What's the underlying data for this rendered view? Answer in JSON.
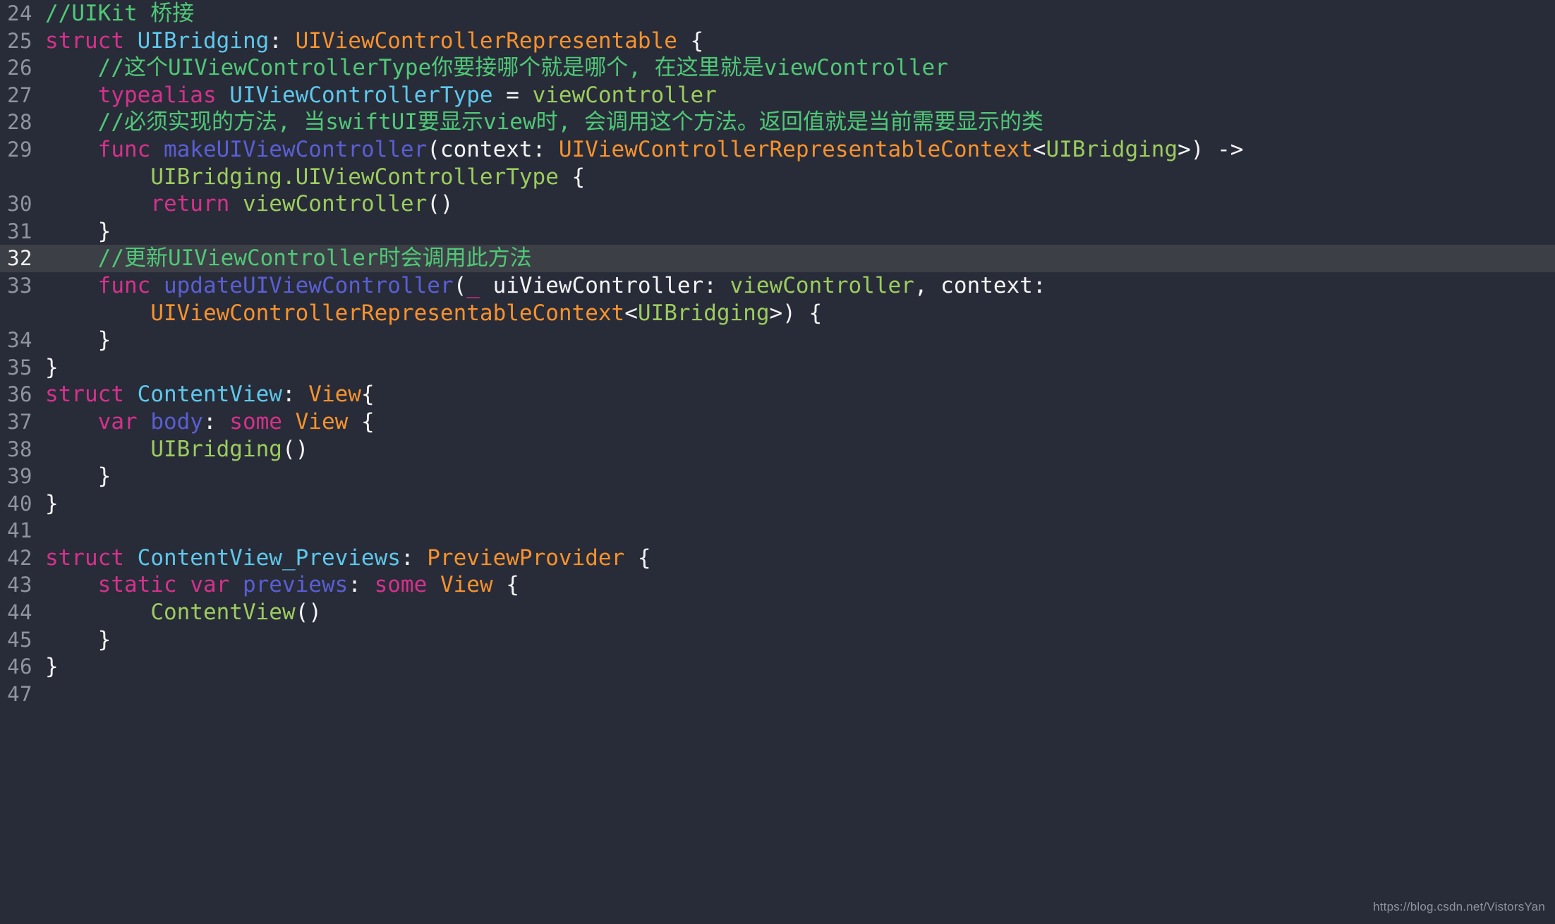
{
  "editor": {
    "theme": {
      "background": "#282c38",
      "active_line_background": "#3c3f45",
      "gutter_text": "#9093a0",
      "gutter_active_text": "#f2f2f4",
      "comment": "#50c878",
      "keyword": "#d6318c",
      "type_declaration": "#5ec8ec",
      "protocol_type": "#f7922e",
      "identifier": "#9ccc5e",
      "function_name": "#5a5ed4",
      "plain": "#f4f4f6"
    },
    "active_line_number": "32",
    "watermark": "https://blog.csdn.net/VistorsYan",
    "lines": [
      {
        "number": "24",
        "active": false,
        "tokens": [
          {
            "c": "cmt",
            "t": "//UIKit 桥接"
          }
        ]
      },
      {
        "number": "25",
        "active": false,
        "tokens": [
          {
            "c": "kw",
            "t": "struct "
          },
          {
            "c": "type",
            "t": "UIBridging"
          },
          {
            "c": "pln",
            "t": ": "
          },
          {
            "c": "prot",
            "t": "UIViewControllerRepresentable"
          },
          {
            "c": "pln",
            "t": " {"
          }
        ]
      },
      {
        "number": "26",
        "active": false,
        "tokens": [
          {
            "c": "cmt",
            "t": "    //这个UIViewControllerType你要接哪个就是哪个, 在这里就是viewController"
          }
        ]
      },
      {
        "number": "27",
        "active": false,
        "tokens": [
          {
            "c": "pln",
            "t": "    "
          },
          {
            "c": "kw",
            "t": "typealias "
          },
          {
            "c": "type",
            "t": "UIViewControllerType"
          },
          {
            "c": "pln",
            "t": " = "
          },
          {
            "c": "idf",
            "t": "viewController"
          }
        ]
      },
      {
        "number": "28",
        "active": false,
        "tokens": [
          {
            "c": "cmt",
            "t": "    //必须实现的方法, 当swiftUI要显示view时, 会调用这个方法。返回值就是当前需要显示的类"
          }
        ]
      },
      {
        "number": "29",
        "active": false,
        "tokens": [
          {
            "c": "pln",
            "t": "    "
          },
          {
            "c": "kw",
            "t": "func "
          },
          {
            "c": "fn",
            "t": "makeUIViewController"
          },
          {
            "c": "pln",
            "t": "(context: "
          },
          {
            "c": "prot",
            "t": "UIViewControllerRepresentableContext"
          },
          {
            "c": "pln",
            "t": "<"
          },
          {
            "c": "idf",
            "t": "UIBridging"
          },
          {
            "c": "pln",
            "t": ">) ->"
          }
        ]
      },
      {
        "number": "",
        "active": false,
        "tokens": [
          {
            "c": "pln",
            "t": "        "
          },
          {
            "c": "idf",
            "t": "UIBridging.UIViewControllerType"
          },
          {
            "c": "pln",
            "t": " {"
          }
        ]
      },
      {
        "number": "30",
        "active": false,
        "tokens": [
          {
            "c": "pln",
            "t": "        "
          },
          {
            "c": "kw",
            "t": "return "
          },
          {
            "c": "idf",
            "t": "viewController"
          },
          {
            "c": "pln",
            "t": "()"
          }
        ]
      },
      {
        "number": "31",
        "active": false,
        "tokens": [
          {
            "c": "pln",
            "t": "    }"
          }
        ]
      },
      {
        "number": "32",
        "active": true,
        "tokens": [
          {
            "c": "cmt",
            "t": "    //更新UIViewController时会调用此方法"
          }
        ]
      },
      {
        "number": "33",
        "active": false,
        "tokens": [
          {
            "c": "pln",
            "t": "    "
          },
          {
            "c": "kw",
            "t": "func "
          },
          {
            "c": "fn",
            "t": "updateUIViewController"
          },
          {
            "c": "pln",
            "t": "("
          },
          {
            "c": "kw",
            "t": "_"
          },
          {
            "c": "pln",
            "t": " uiViewController: "
          },
          {
            "c": "idf",
            "t": "viewController"
          },
          {
            "c": "pln",
            "t": ", context:"
          }
        ]
      },
      {
        "number": "",
        "active": false,
        "tokens": [
          {
            "c": "pln",
            "t": "        "
          },
          {
            "c": "prot",
            "t": "UIViewControllerRepresentableContext"
          },
          {
            "c": "pln",
            "t": "<"
          },
          {
            "c": "idf",
            "t": "UIBridging"
          },
          {
            "c": "pln",
            "t": ">) {"
          }
        ]
      },
      {
        "number": "34",
        "active": false,
        "tokens": [
          {
            "c": "pln",
            "t": "    }"
          }
        ]
      },
      {
        "number": "35",
        "active": false,
        "tokens": [
          {
            "c": "pln",
            "t": "}"
          }
        ]
      },
      {
        "number": "36",
        "active": false,
        "tokens": [
          {
            "c": "kw",
            "t": "struct "
          },
          {
            "c": "type",
            "t": "ContentView"
          },
          {
            "c": "pln",
            "t": ": "
          },
          {
            "c": "prot",
            "t": "View"
          },
          {
            "c": "pln",
            "t": "{"
          }
        ]
      },
      {
        "number": "37",
        "active": false,
        "tokens": [
          {
            "c": "pln",
            "t": "    "
          },
          {
            "c": "kw",
            "t": "var "
          },
          {
            "c": "fn",
            "t": "body"
          },
          {
            "c": "pln",
            "t": ": "
          },
          {
            "c": "kw",
            "t": "some "
          },
          {
            "c": "prot",
            "t": "View"
          },
          {
            "c": "pln",
            "t": " {"
          }
        ]
      },
      {
        "number": "38",
        "active": false,
        "tokens": [
          {
            "c": "pln",
            "t": "        "
          },
          {
            "c": "idf",
            "t": "UIBridging"
          },
          {
            "c": "pln",
            "t": "()"
          }
        ]
      },
      {
        "number": "39",
        "active": false,
        "tokens": [
          {
            "c": "pln",
            "t": "    }"
          }
        ]
      },
      {
        "number": "40",
        "active": false,
        "tokens": [
          {
            "c": "pln",
            "t": "}"
          }
        ]
      },
      {
        "number": "41",
        "active": false,
        "tokens": []
      },
      {
        "number": "42",
        "active": false,
        "tokens": [
          {
            "c": "kw",
            "t": "struct "
          },
          {
            "c": "type",
            "t": "ContentView_Previews"
          },
          {
            "c": "pln",
            "t": ": "
          },
          {
            "c": "prot",
            "t": "PreviewProvider"
          },
          {
            "c": "pln",
            "t": " {"
          }
        ]
      },
      {
        "number": "43",
        "active": false,
        "tokens": [
          {
            "c": "pln",
            "t": "    "
          },
          {
            "c": "kw",
            "t": "static "
          },
          {
            "c": "kw",
            "t": "var "
          },
          {
            "c": "fn",
            "t": "previews"
          },
          {
            "c": "pln",
            "t": ": "
          },
          {
            "c": "kw",
            "t": "some "
          },
          {
            "c": "prot",
            "t": "View"
          },
          {
            "c": "pln",
            "t": " {"
          }
        ]
      },
      {
        "number": "44",
        "active": false,
        "tokens": [
          {
            "c": "pln",
            "t": "        "
          },
          {
            "c": "idf",
            "t": "ContentView"
          },
          {
            "c": "pln",
            "t": "()"
          }
        ]
      },
      {
        "number": "45",
        "active": false,
        "tokens": [
          {
            "c": "pln",
            "t": "    }"
          }
        ]
      },
      {
        "number": "46",
        "active": false,
        "tokens": [
          {
            "c": "pln",
            "t": "}"
          }
        ]
      },
      {
        "number": "47",
        "active": false,
        "tokens": []
      }
    ]
  }
}
